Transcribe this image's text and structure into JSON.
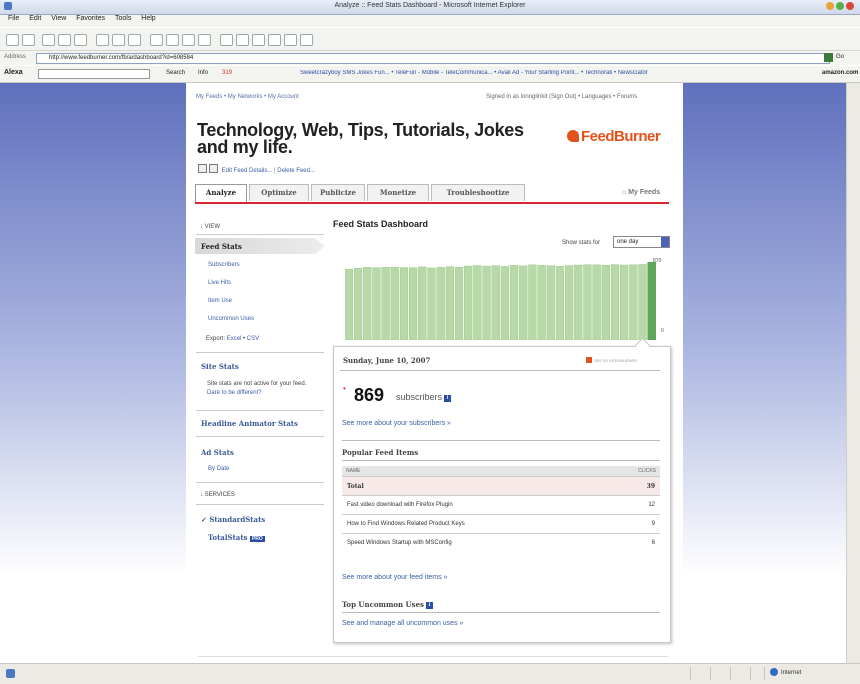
{
  "window": {
    "title": "Analyze :: Feed Stats Dashboard - Microsoft Internet Explorer"
  },
  "menu": [
    "File",
    "Edit",
    "View",
    "Favorites",
    "Tools",
    "Help"
  ],
  "address": {
    "label": "Address",
    "url": "http://www.feedburner.com/fb/a/dashboard?id=608584",
    "go": "Go"
  },
  "alexa": {
    "label": "Alexa",
    "search": "Search",
    "info": "Info",
    "rank": "319",
    "links": "Sweetcrazyboy SMS Jokes Fun...  • TeleFun - Mobile - TeleCommunica...  • Avail Ad - Your Starting Point...  • Technorati  • NewsGator",
    "amazon": "amazon.com"
  },
  "page": {
    "topnav": "My Feeds • My Networks • My Account",
    "signed": "Signed in as lonnglinkit (Sign Out) • Languages • Forums",
    "site_title": "Technology, Web, Tips, Tutorials, Jokes and my life.",
    "logo": "FeedBurner",
    "edit_feed": "Edit Feed Details...",
    "delete_feed": "Delete Feed...",
    "tabs": [
      "Analyze",
      "Optimize",
      "Publicize",
      "Monetize",
      "Troubleshootize"
    ],
    "my_feeds": "My Feeds"
  },
  "sidebar": {
    "view_header": "VIEW",
    "feed_stats": "Feed Stats",
    "subscribers": "Subscribers",
    "live_hits": "Live Hits",
    "item_use": "Item Use",
    "uncommon_uses": "Uncommon Uses",
    "export_label": "Export:",
    "export_excel": "Excel",
    "export_csv": "CSV",
    "site_stats": "Site Stats",
    "site_stats_note": "Site stats are not active for your feed.",
    "site_stats_link": "Dare to be different?",
    "headline_animator": "Headline Animator Stats",
    "ad_stats": "Ad Stats",
    "by_date": "By Date",
    "services_header": "SERVICES",
    "standard_stats": "StandardStats",
    "total_stats": "TotalStats",
    "pro_badge": "PRO"
  },
  "main": {
    "title": "Feed Stats Dashboard",
    "show_for_label": "Show stats for",
    "show_for_value": "one day",
    "y_max_label": "870",
    "y_min_label": "0"
  },
  "chart_data": {
    "type": "bar",
    "title": "",
    "ylim": [
      0,
      870
    ],
    "values": [
      790,
      800,
      810,
      805,
      810,
      812,
      808,
      806,
      815,
      803,
      810,
      818,
      812,
      825,
      830,
      824,
      828,
      820,
      832,
      826,
      838,
      832,
      828,
      822,
      830,
      836,
      840,
      838,
      833,
      840,
      836,
      838,
      842,
      869
    ],
    "highlight_last": true,
    "colors": {
      "bar": "#b7d9a8",
      "highlight": "#5fa85a"
    }
  },
  "popup": {
    "date": "Sunday, June 10, 2007",
    "badge": "SEE BY FEEDBURNER",
    "subscriber_count": "869",
    "subscriber_label": "subscribers",
    "more_subscribers": "See more about your subscribers »",
    "popular_heading": "Popular Feed Items",
    "table": {
      "col_name": "NAME",
      "col_clicks": "CLICKS",
      "rows": [
        {
          "name": "Total",
          "clicks": "39"
        },
        {
          "name": "Fast video download with Firefox Plugin",
          "clicks": "12"
        },
        {
          "name": "How to Find Windows Related Product Keys",
          "clicks": "9"
        },
        {
          "name": "Speed Windows Startup with MSConfig",
          "clicks": "6"
        }
      ]
    },
    "more_items": "See more about your feed items »",
    "uncommon_heading": "Top Uncommon Uses",
    "manage_uncommon": "See and manage all uncommon uses »"
  },
  "status": {
    "zone": "Internet"
  }
}
